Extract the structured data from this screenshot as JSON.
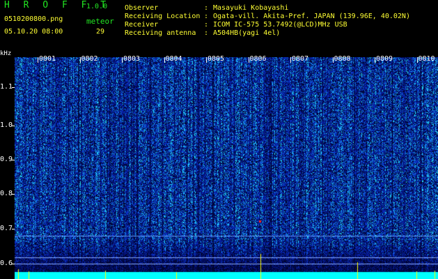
{
  "header": {
    "app_title": "H R O F F T",
    "version": "1.0.0",
    "filename": "0510200800.png",
    "datetime": "05.10.20 08:00",
    "meteor_label": "meteor",
    "meteor_count": "29"
  },
  "info": [
    {
      "label": "Observer",
      "value": "Masayuki Kobayashi"
    },
    {
      "label": "Receiving Location",
      "value": "Ogata-vill. Akita-Pref. JAPAN (139.96E, 40.02N)"
    },
    {
      "label": "Receiver",
      "value": "ICOM IC-575 53.7492(@LCD)MHz USB"
    },
    {
      "label": "Receiving antenna",
      "value": "A504HB(yagi 4el)"
    }
  ],
  "separator": ":",
  "axis": {
    "y_unit": "kHz",
    "y_ticks": [
      "1.1",
      "1.0",
      "0.9",
      "0.8",
      "0.7",
      "0.6"
    ],
    "x_ticks": [
      "0801",
      "0802",
      "0803",
      "0804",
      "0805",
      "0806",
      "0807",
      "0808",
      "0809",
      "0810"
    ]
  },
  "colors": {
    "background": "#000000",
    "header_green": "#22e622",
    "header_yellow": "#ffff33",
    "axis_white": "#ffffff",
    "noise_base": "#0a1a8a",
    "noise_high": "#00d0ff",
    "baseline_cyan": "#00ffff",
    "meteor_yellow": "#ffff00"
  }
}
